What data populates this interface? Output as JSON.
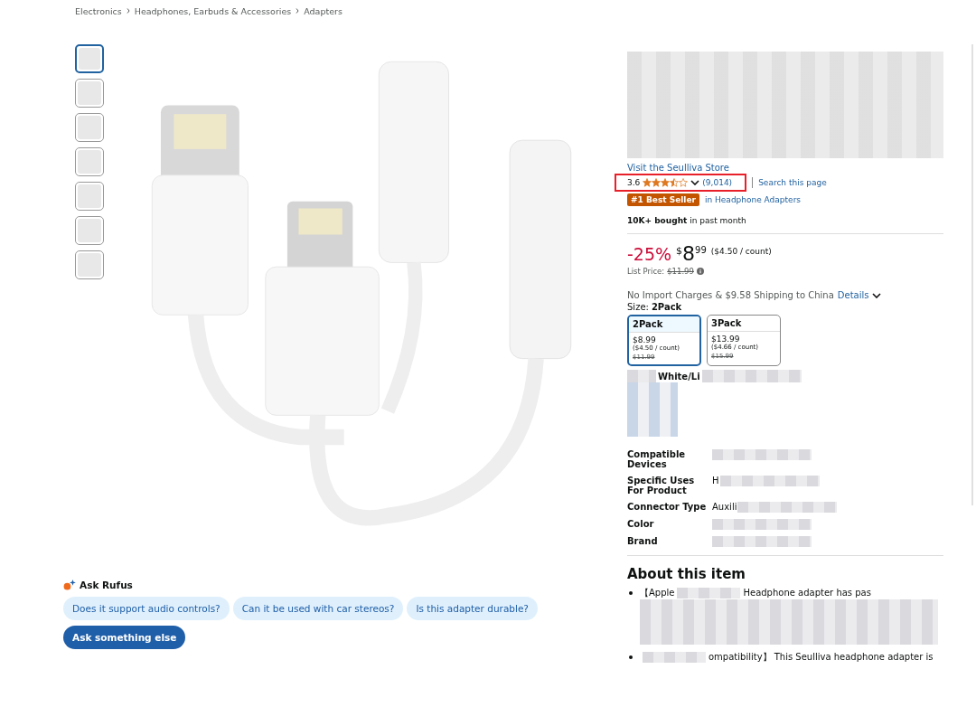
{
  "breadcrumb": [
    "Electronics",
    "Headphones, Earbuds & Accessories",
    "Adapters"
  ],
  "thumbnails": [
    {
      "selected": true
    },
    {
      "selected": false
    },
    {
      "selected": false
    },
    {
      "selected": false
    },
    {
      "selected": false
    },
    {
      "selected": false
    },
    {
      "selected": false
    }
  ],
  "rufus": {
    "title": "Ask Rufus",
    "questions": [
      "Does it support audio controls?",
      "Can it be used with car stereos?",
      "Is this adapter durable?"
    ],
    "ask_button": "Ask something else"
  },
  "store_link": "Visit the Seulliva Store",
  "rating": {
    "score": "3.6",
    "stars": 3.5,
    "count": "(9,014)",
    "highlighted": true
  },
  "search_link": "Search this page",
  "badge": {
    "label": "#1 Best Seller",
    "category": "in Headphone Adapters"
  },
  "bought": "**10K+ bought** in past month",
  "price": {
    "discount": "-25%",
    "currency": "$",
    "whole": "8",
    "fraction": "99",
    "unit": "($4.50 / count)",
    "list_label": "List Price:",
    "list_price": "$11.99"
  },
  "shipping": {
    "text": "No Import Charges & $9.58 Shipping to China",
    "details": "Details"
  },
  "size": {
    "label": "Size:",
    "value": "2Pack"
  },
  "size_options": [
    {
      "name": "2Pack",
      "price": "$8.99",
      "unit": "($4.50 / count)",
      "old": "$11.99",
      "selected": true
    },
    {
      "name": "3Pack",
      "price": "$13.99",
      "unit": "($4.66 / count)",
      "old": "$15.99",
      "selected": false
    }
  ],
  "color_value": "White/Li",
  "specs": [
    {
      "label": "Compatible Devices"
    },
    {
      "label": "Specific Uses For Product",
      "value": "H"
    },
    {
      "label": "Connector Type",
      "value": "Auxili"
    },
    {
      "label": "Color"
    },
    {
      "label": "Brand"
    }
  ],
  "about": {
    "title": "About this item",
    "bullets": [
      {
        "start": "【Apple",
        "end": "Headphone adapter has pas"
      },
      {
        "end": "ompatibility】 This Seulliva headphone adapter is"
      }
    ]
  }
}
